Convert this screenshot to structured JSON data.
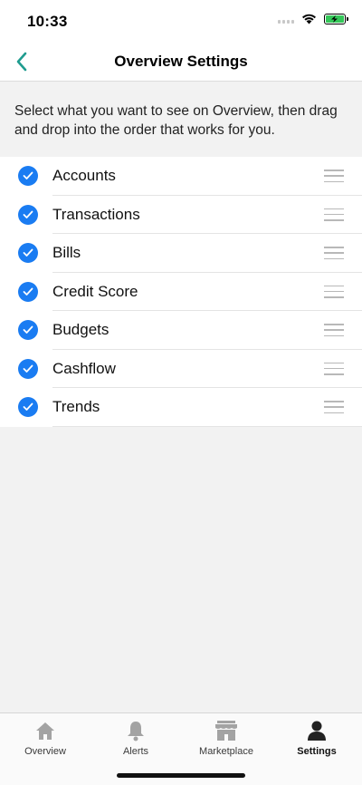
{
  "status_bar": {
    "time": "10:33"
  },
  "nav": {
    "title": "Overview Settings"
  },
  "description": "Select what you want to see on Overview, then drag and drop into the order that works for you.",
  "items": [
    {
      "label": "Accounts",
      "checked": true
    },
    {
      "label": "Transactions",
      "checked": true
    },
    {
      "label": "Bills",
      "checked": true
    },
    {
      "label": "Credit Score",
      "checked": true
    },
    {
      "label": "Budgets",
      "checked": true
    },
    {
      "label": "Cashflow",
      "checked": true
    },
    {
      "label": "Trends",
      "checked": true
    }
  ],
  "tabs": [
    {
      "label": "Overview",
      "icon": "home-icon",
      "active": false
    },
    {
      "label": "Alerts",
      "icon": "bell-icon",
      "active": false
    },
    {
      "label": "Marketplace",
      "icon": "store-icon",
      "active": false
    },
    {
      "label": "Settings",
      "icon": "user-icon",
      "active": true
    }
  ],
  "colors": {
    "accent": "#1a7cf2",
    "back_arrow": "#1f9c8f",
    "battery": "#34c759"
  }
}
